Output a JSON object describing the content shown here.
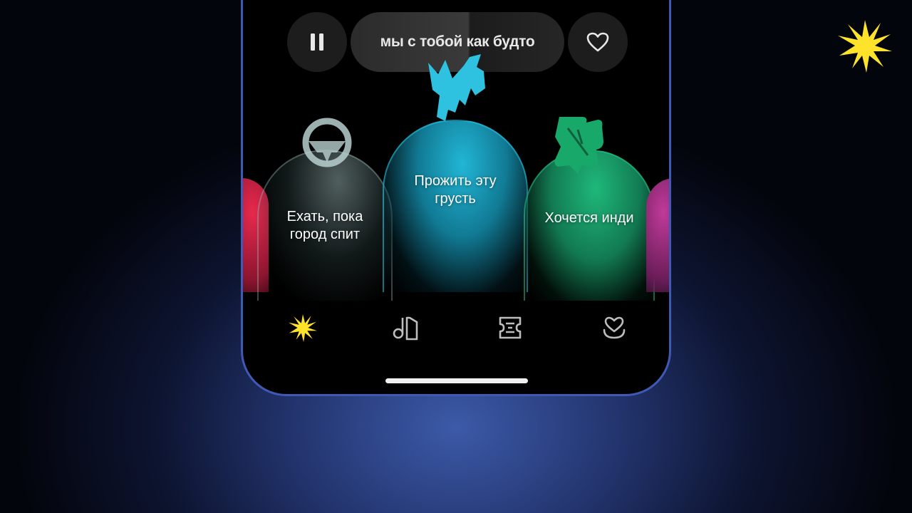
{
  "now_playing": {
    "title": "мы с тобой как будто"
  },
  "carousel": {
    "cards": [
      {
        "label": "Ехать, пока\nгород спит",
        "icon": "steering-wheel-icon"
      },
      {
        "label": "Прожить эту\nгрусть",
        "icon": "cloud-hand-icon"
      },
      {
        "label": "Хочется инди",
        "icon": "leaf-icon"
      }
    ]
  },
  "tabbar": {
    "tabs": [
      {
        "name": "main",
        "icon": "sparkle-icon",
        "active": true
      },
      {
        "name": "collection",
        "icon": "collection-icon",
        "active": false
      },
      {
        "name": "podcasts",
        "icon": "ticket-icon",
        "active": false
      },
      {
        "name": "favorites",
        "icon": "heart-smile-icon",
        "active": false
      }
    ]
  },
  "colors": {
    "accent": "#ffe32a",
    "card_drive": "#8fb3b3",
    "card_sad": "#22b6d6",
    "card_indie": "#1fb87a",
    "card_edge_left": "#e8294d",
    "card_edge_right": "#c03a9a",
    "phone_border": "#3e5ab4"
  }
}
